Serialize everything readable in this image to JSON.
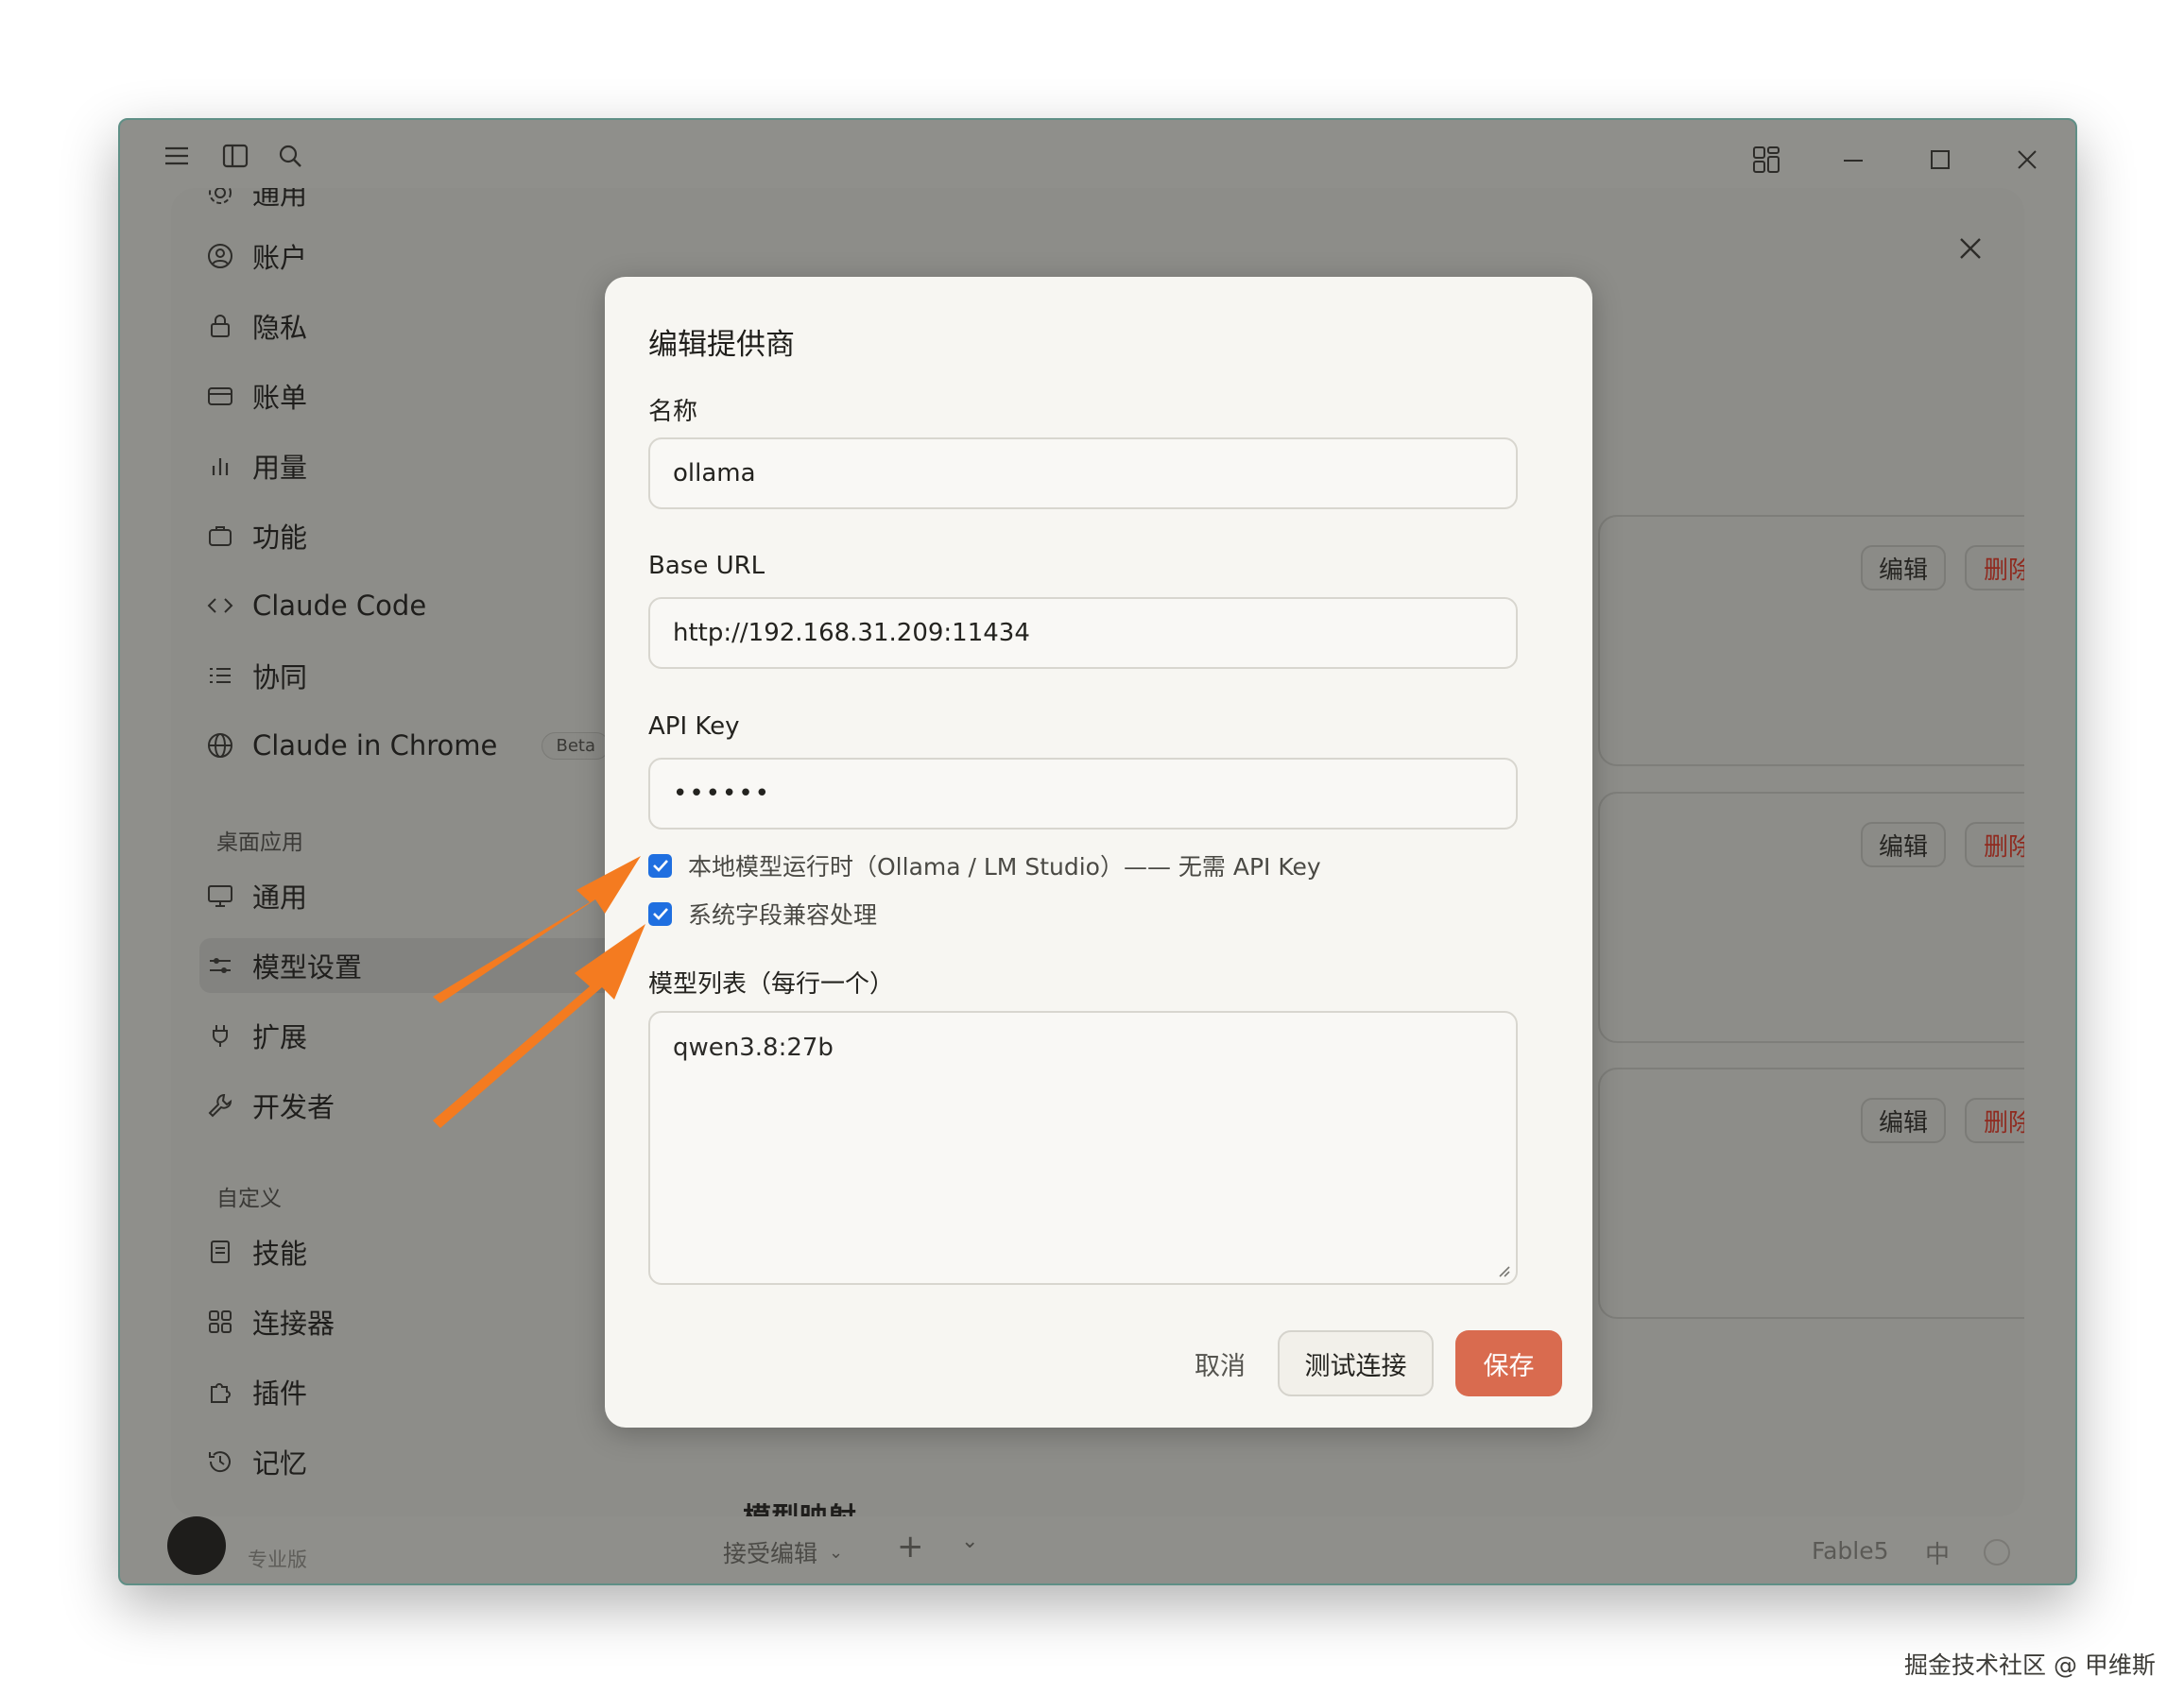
{
  "sidebar": {
    "partial_top_item": "通用",
    "items": [
      {
        "label": "账户",
        "icon": "user-circle-icon"
      },
      {
        "label": "隐私",
        "icon": "lock-icon"
      },
      {
        "label": "账单",
        "icon": "credit-card-icon"
      },
      {
        "label": "用量",
        "icon": "bar-chart-icon"
      },
      {
        "label": "功能",
        "icon": "briefcase-icon"
      },
      {
        "label": "Claude Code",
        "icon": "code-icon"
      },
      {
        "label": "协同",
        "icon": "list-icon"
      },
      {
        "label": "Claude in Chrome",
        "icon": "globe-icon",
        "badge": "Beta"
      }
    ],
    "section_desktop": "桌面应用",
    "desktop_items": [
      {
        "label": "通用",
        "icon": "monitor-icon"
      },
      {
        "label": "模型设置",
        "icon": "sliders-icon",
        "active": true
      },
      {
        "label": "扩展",
        "icon": "plug-icon"
      },
      {
        "label": "开发者",
        "icon": "wrench-icon"
      }
    ],
    "section_custom": "自定义",
    "custom_items": [
      {
        "label": "技能",
        "icon": "document-icon"
      },
      {
        "label": "连接器",
        "icon": "grid-icon"
      },
      {
        "label": "插件",
        "icon": "puzzle-icon"
      },
      {
        "label": "记忆",
        "icon": "history-icon"
      }
    ]
  },
  "cards": {
    "edit_label": "编辑",
    "delete_label": "删除"
  },
  "background": {
    "section_heading": "模型映射",
    "plan_label": "专业版",
    "accept_edits": "接受编辑",
    "model_name": "Fable5",
    "lang_label": "中"
  },
  "modal": {
    "title": "编辑提供商",
    "name_label": "名称",
    "name_value": "ollama",
    "base_url_label": "Base URL",
    "base_url_value": "http://192.168.31.209:11434",
    "api_key_label": "API Key",
    "api_key_value": "••••••",
    "check_local_label": "本地模型运行时（Ollama / LM Studio）—— 无需 API Key",
    "check_local_checked": true,
    "check_compat_label": "系统字段兼容处理",
    "check_compat_checked": true,
    "models_label": "模型列表（每行一个）",
    "models_value": "qwen3.8:27b",
    "cancel_label": "取消",
    "test_label": "测试连接",
    "save_label": "保存"
  },
  "watermark": "掘金技术社区 @ 甲维斯",
  "colors": {
    "accent": "#d96b4f",
    "checkbox": "#1f6fe0",
    "annotation_arrow": "#f47b20",
    "danger": "#8f2a1f"
  }
}
